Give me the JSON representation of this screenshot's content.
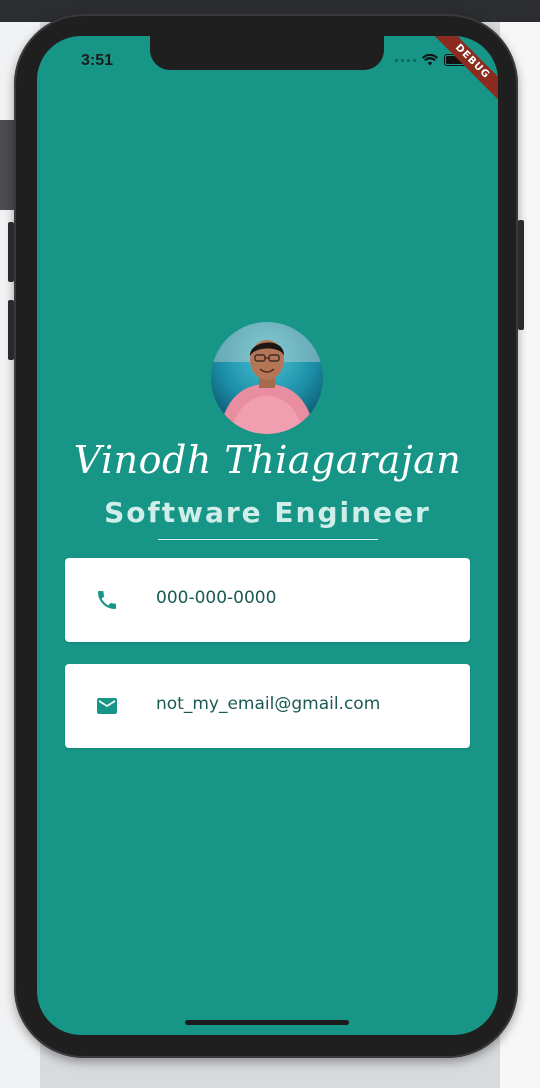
{
  "status_bar": {
    "time": "3:51"
  },
  "debug_banner": {
    "label": "DEBUG"
  },
  "profile": {
    "name": "Vinodh Thiagarajan",
    "title": "Software Engineer"
  },
  "contacts": [
    {
      "icon": "phone-icon",
      "value": "000-000-0000"
    },
    {
      "icon": "mail-icon",
      "value": "not_my_email@gmail.com"
    }
  ],
  "colors": {
    "background": "#179688",
    "card": "#ffffff",
    "name": "#ffffff",
    "title": "#cfeee9",
    "icon": "#179688"
  }
}
